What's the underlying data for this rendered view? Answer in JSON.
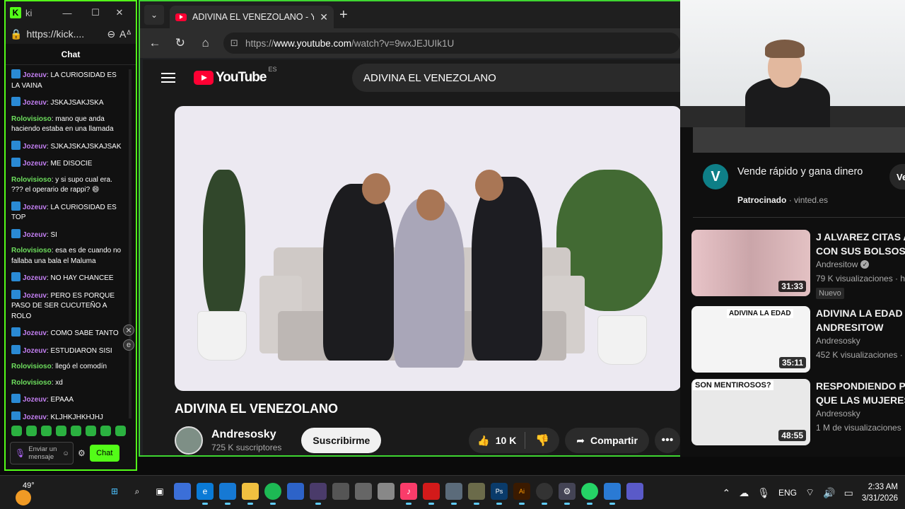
{
  "kick": {
    "tab_title": "ki",
    "url": "https://kick....",
    "chat_header": "Chat",
    "messages": [
      {
        "user": "Jozeuv",
        "text": "LA CURIOSIDAD ES LA VAINA",
        "badge": true,
        "color": "#c37ff2"
      },
      {
        "user": "Jozeuv",
        "text": "JSKAJSAKJSKA",
        "badge": true,
        "color": "#c37ff2"
      },
      {
        "user": "Rolovisioso",
        "text": "mano que anda haciendo estaba en una llamada",
        "badge": false,
        "color": "#6ee05e"
      },
      {
        "user": "Jozeuv",
        "text": "SJKAJSKAJSKAJSAK",
        "badge": true,
        "color": "#c37ff2"
      },
      {
        "user": "Jozeuv",
        "text": "ME DISOCIE",
        "badge": true,
        "color": "#c37ff2"
      },
      {
        "user": "Rolovisioso",
        "text": "y si supo cual era. ??? el operario de rappi? 😄",
        "badge": false,
        "color": "#6ee05e"
      },
      {
        "user": "Jozeuv",
        "text": "LA CURIOSIDAD ES TOP",
        "badge": true,
        "color": "#c37ff2"
      },
      {
        "user": "Jozeuv",
        "text": "SI",
        "badge": true,
        "color": "#c37ff2"
      },
      {
        "user": "Rolovisioso",
        "text": "esa es de cuando no fallaba una bala el Maluma",
        "badge": false,
        "color": "#6ee05e"
      },
      {
        "user": "Jozeuv",
        "text": "NO HAY CHANCEE",
        "badge": true,
        "color": "#c37ff2"
      },
      {
        "user": "Jozeuv",
        "text": "PERO ES PORQUE PASO DE SER CUCUTEÑO A ROLO",
        "badge": true,
        "color": "#c37ff2"
      },
      {
        "user": "Jozeuv",
        "text": "COMO SABE TANTO",
        "badge": true,
        "color": "#c37ff2"
      },
      {
        "user": "Jozeuv",
        "text": "ESTUDIARON SISI",
        "badge": true,
        "color": "#c37ff2"
      },
      {
        "user": "Rolovisioso",
        "text": "llegó el comodín",
        "badge": false,
        "color": "#6ee05e"
      },
      {
        "user": "Rolovisioso",
        "text": "xd",
        "badge": false,
        "color": "#6ee05e"
      },
      {
        "user": "Jozeuv",
        "text": "EPAAA",
        "badge": true,
        "color": "#c37ff2"
      },
      {
        "user": "Jozeuv",
        "text": "KLJHKJHKHJHJ",
        "badge": true,
        "color": "#c37ff2"
      }
    ],
    "input_placeholder": "Enviar un mensaje",
    "chat_button": "Chat",
    "accent": "#53fc18"
  },
  "browser": {
    "tab_title": "ADIVINA EL VENEZOLANO - YouTube",
    "url_prefix": "https://",
    "url_host": "www.youtube.com",
    "url_path": "/watch?v=9wxJEJUIk1U"
  },
  "youtube": {
    "logo_text": "YouTube",
    "region": "ES",
    "search_value": "ADIVINA EL VENEZOLANO",
    "video_title": "ADIVINA EL VENEZOLANO",
    "channel_name": "Andresosky",
    "subscribers": "725 K suscriptores",
    "subscribe_label": "Suscribirme",
    "likes": "10 K",
    "share_label": "Compartir",
    "ad": {
      "logo_letter": "V",
      "title": "Vende rápido y gana dinero",
      "sponsor_label": "Patrocinado",
      "sponsor_domain": "vinted.es",
      "cta": "Ve"
    },
    "recommendations": [
      {
        "title": "J ALVAREZ CITAS A CON SUS BOLSOS",
        "channel": "Andresitow",
        "verified": true,
        "views": "79 K visualizaciones · h",
        "badge": "Nuevo",
        "duration": "31:33"
      },
      {
        "title": "ADIVINA LA EDAD - ANDRESITOW",
        "channel": "Andresosky",
        "verified": false,
        "views": "452 K visualizaciones ·",
        "badge": "",
        "duration": "35:11",
        "thumb_text": "ADIVINA LA EDAD"
      },
      {
        "title": "RESPONDIENDO PR QUE LAS MUJERES",
        "channel": "Andresosky",
        "verified": false,
        "views": "1 M de visualizaciones",
        "badge": "",
        "duration": "48:55",
        "thumb_text": "SON MENTIROSOS?"
      }
    ]
  },
  "taskbar": {
    "temperature": "49°",
    "language": "ENG",
    "time": "2:33 AM",
    "date": "3/31/2026"
  }
}
